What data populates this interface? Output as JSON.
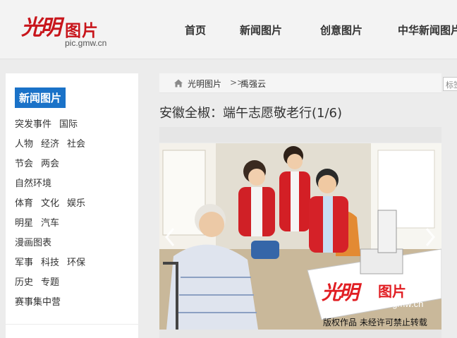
{
  "header": {
    "logo_brush": "光明",
    "logo_text": "图片",
    "logo_url": "pic.gmw.cn",
    "nav": [
      "首页",
      "新闻图片",
      "创意图片",
      "中华新闻图片"
    ]
  },
  "sidebar": {
    "title": "新闻图片",
    "rows": [
      [
        "突发事件",
        "国际"
      ],
      [
        "人物",
        "经济",
        "社会"
      ],
      [
        "节会",
        "两会"
      ],
      [
        "自然环境"
      ],
      [
        "体育",
        "文化",
        "娱乐"
      ],
      [
        "明星",
        "汽车"
      ],
      [
        "漫画图表"
      ],
      [
        "军事",
        "科技",
        "环保"
      ],
      [
        "历史",
        "专题"
      ],
      [
        "赛事集中营"
      ]
    ]
  },
  "breadcrumb": {
    "section": "光明图片",
    "separator": ">>",
    "author": "禹强云"
  },
  "tag_input": {
    "placeholder": "标签"
  },
  "article": {
    "title": "安徽全椒：端午志愿敬老行(1/6)"
  },
  "photo": {
    "watermark_brush": "光明",
    "watermark_text": "图片",
    "watermark_url": "pic.gmw.cn",
    "copyright": "版权作品  未经许可禁止转载"
  },
  "icons": {
    "home": "home-icon",
    "prev": "chevron-left-icon",
    "next": "chevron-right-icon"
  },
  "colors": {
    "brand_red": "#c8151b",
    "tab_blue": "#1a72c8"
  }
}
